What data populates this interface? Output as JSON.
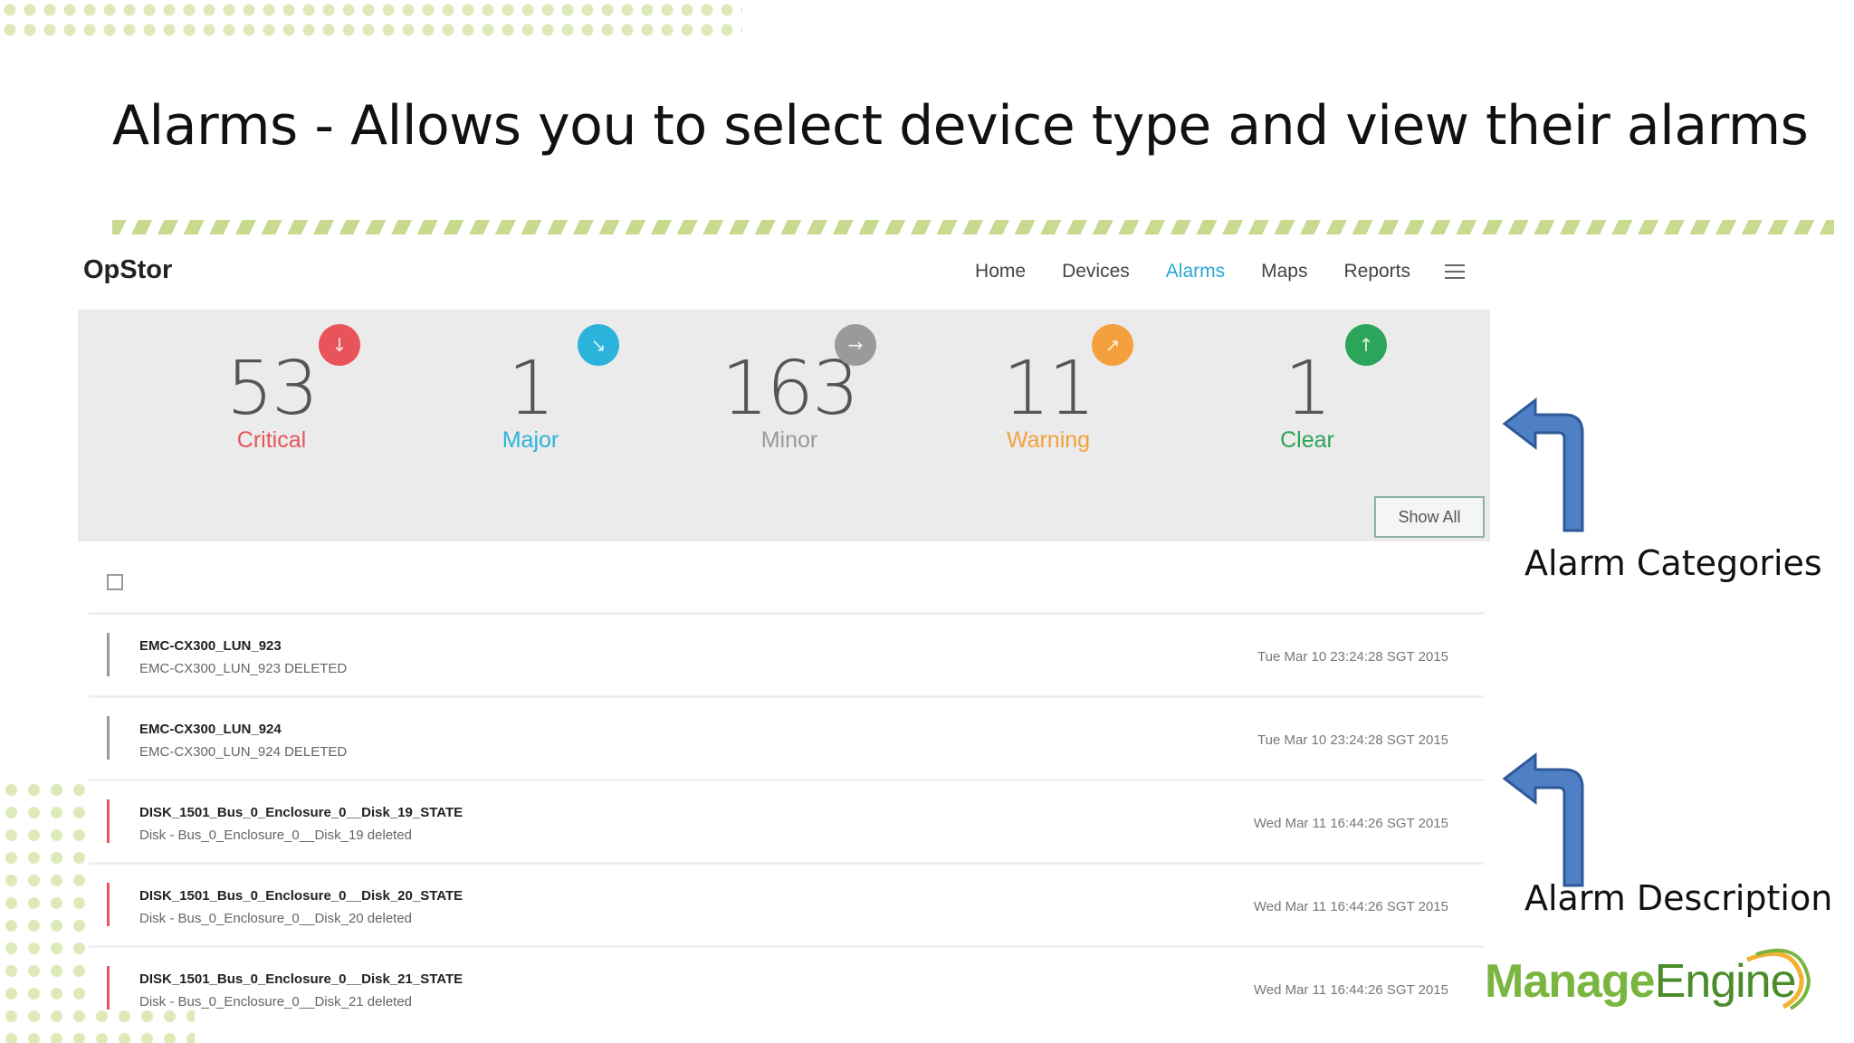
{
  "slide": {
    "title": "Alarms - Allows you to select device type and view their alarms",
    "annotations": [
      "Alarm Categories",
      "Alarm Description"
    ],
    "logo": {
      "part1": "Manage",
      "part2": "Engine"
    }
  },
  "app": {
    "brand": "OpStor",
    "nav": [
      {
        "label": "Home",
        "active": false
      },
      {
        "label": "Devices",
        "active": false
      },
      {
        "label": "Alarms",
        "active": true
      },
      {
        "label": "Maps",
        "active": false
      },
      {
        "label": "Reports",
        "active": false
      }
    ],
    "categories": [
      {
        "count": "53",
        "label": "Critical",
        "color": "#e8545a",
        "icon": "arrow-down-icon",
        "glyph": "↓"
      },
      {
        "count": "1",
        "label": "Major",
        "color": "#2bb3dc",
        "icon": "arrow-down-right-icon",
        "glyph": "↘"
      },
      {
        "count": "163",
        "label": "Minor",
        "color": "#9a9a9a",
        "icon": "arrow-right-icon",
        "glyph": "→"
      },
      {
        "count": "11",
        "label": "Warning",
        "color": "#f4a03c",
        "icon": "arrow-up-right-icon",
        "glyph": "↗"
      },
      {
        "count": "1",
        "label": "Clear",
        "color": "#2aa55a",
        "icon": "arrow-up-icon",
        "glyph": "↑"
      }
    ],
    "show_all_label": "Show All",
    "alarms": [
      {
        "name": "EMC-CX300_LUN_923",
        "description": "EMC-CX300_LUN_923 DELETED",
        "time": "Tue Mar 10 23:24:28 SGT 2015",
        "severity_color": "#999999"
      },
      {
        "name": "EMC-CX300_LUN_924",
        "description": "EMC-CX300_LUN_924 DELETED",
        "time": "Tue Mar 10 23:24:28 SGT 2015",
        "severity_color": "#999999"
      },
      {
        "name": "DISK_1501_Bus_0_Enclosure_0__Disk_19_STATE",
        "description": "Disk - Bus_0_Enclosure_0__Disk_19 deleted",
        "time": "Wed Mar 11 16:44:26 SGT 2015",
        "severity_color": "#e8545a"
      },
      {
        "name": "DISK_1501_Bus_0_Enclosure_0__Disk_20_STATE",
        "description": "Disk - Bus_0_Enclosure_0__Disk_20 deleted",
        "time": "Wed Mar 11 16:44:26 SGT 2015",
        "severity_color": "#e8545a"
      },
      {
        "name": "DISK_1501_Bus_0_Enclosure_0__Disk_21_STATE",
        "description": "Disk - Bus_0_Enclosure_0__Disk_21 deleted",
        "time": "Wed Mar 11 16:44:26 SGT 2015",
        "severity_color": "#e8545a"
      }
    ]
  }
}
